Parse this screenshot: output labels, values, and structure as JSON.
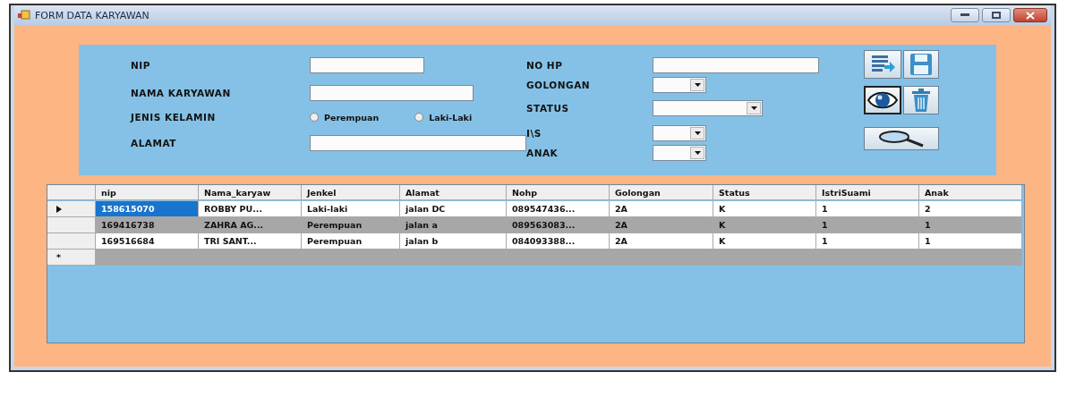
{
  "window": {
    "title": "FORM DATA KARYAWAN"
  },
  "form": {
    "left_fields": [
      {
        "label": "NIP",
        "kind": "text"
      },
      {
        "label": "NAMA KARYAWAN",
        "kind": "text"
      },
      {
        "label": "JENIS KELAMIN",
        "kind": "radio",
        "options": [
          {
            "label": "Perempuan",
            "selected": false
          },
          {
            "label": "Laki-Laki",
            "selected": false
          }
        ]
      },
      {
        "label": "ALAMAT",
        "kind": "text"
      }
    ],
    "right_fields": [
      {
        "label": "NO HP",
        "kind": "text"
      },
      {
        "label": "GOLONGAN",
        "kind": "select"
      },
      {
        "label": "STATUS",
        "kind": "select"
      },
      {
        "label": "I\\S",
        "kind": "select"
      },
      {
        "label": "ANAK",
        "kind": "select"
      }
    ]
  },
  "table": {
    "columns": [
      "nip",
      "Nama_karyaw",
      "Jenkel",
      "Alamat",
      "Nohp",
      "Golongan",
      "Status",
      "IstriSuami",
      "Anak"
    ],
    "rows": [
      {
        "current": true,
        "cells": [
          "158615070",
          "ROBBY PU...",
          "Laki-laki",
          "jalan DC",
          "089547436...",
          "2A",
          "K",
          "1",
          "2"
        ]
      },
      {
        "current": false,
        "cells": [
          "169416738",
          "ZAHRA AG...",
          "Perempuan",
          "jalan a",
          "089563083...",
          "2A",
          "K",
          "1",
          "1"
        ]
      },
      {
        "current": false,
        "cells": [
          "169516684",
          "TRI SANT...",
          "Perempuan",
          "jalan b",
          "084093388...",
          "2A",
          "K",
          "1",
          "1"
        ]
      }
    ],
    "new_row_marker": "*"
  }
}
